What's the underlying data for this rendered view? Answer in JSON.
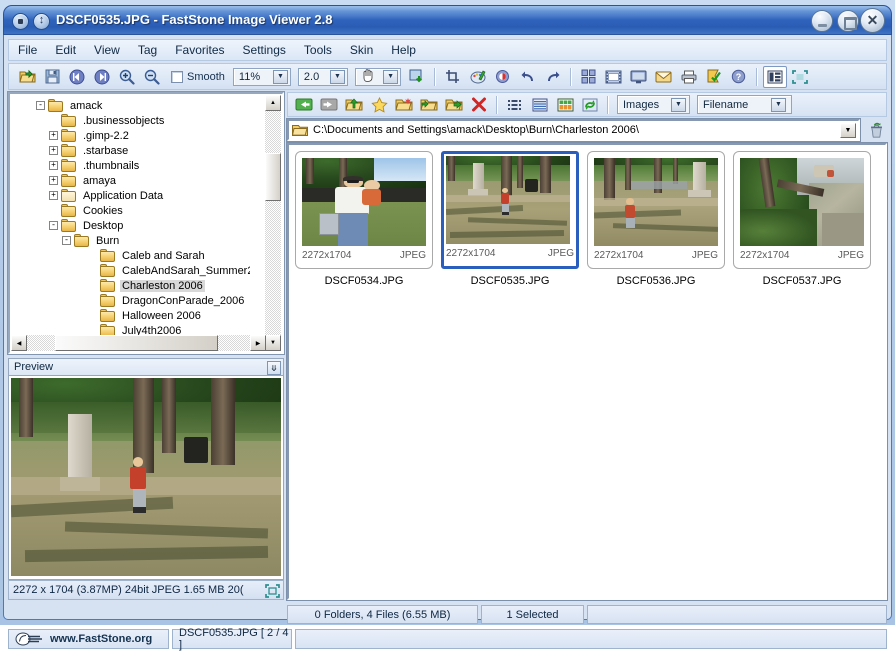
{
  "window": {
    "title": "DSCF0535.JPG  -  FastStone Image Viewer 2.8",
    "sys_menu_icon": "square-icon",
    "sys_restore_icon": "updown-arrow-icon",
    "minimize_label": "minimize-icon",
    "maximize_label": "maximize-icon",
    "close_label": "close-icon"
  },
  "menu": {
    "items": [
      {
        "label": "File"
      },
      {
        "label": "Edit"
      },
      {
        "label": "View"
      },
      {
        "label": "Tag"
      },
      {
        "label": "Favorites"
      },
      {
        "label": "Settings"
      },
      {
        "label": "Tools"
      },
      {
        "label": "Skin"
      },
      {
        "label": "Help"
      }
    ]
  },
  "toolbar_main": {
    "buttons": [
      {
        "name": "open-folder-icon",
        "tip": "Open"
      },
      {
        "name": "save-icon",
        "tip": "Save"
      },
      {
        "name": "previous-image-icon",
        "tip": "Previous"
      },
      {
        "name": "next-image-icon",
        "tip": "Next"
      },
      {
        "name": "zoom-in-icon",
        "tip": "Zoom In"
      },
      {
        "name": "zoom-out-icon",
        "tip": "Zoom Out"
      }
    ],
    "smooth_label": "Smooth",
    "smooth_checked": false,
    "zoom_value": "11%",
    "gamma_value": "2.0",
    "hand_value": "✋",
    "right_buttons": [
      {
        "name": "fit-window-icon"
      },
      {
        "name": "crop-icon"
      },
      {
        "name": "draw-board-icon"
      },
      {
        "name": "red-eye-icon"
      },
      {
        "name": "undo-icon"
      },
      {
        "name": "redo-icon"
      },
      {
        "name": "contact-sheet-icon"
      },
      {
        "name": "slideshow-film-icon"
      },
      {
        "name": "fullscreen-monitor-icon"
      },
      {
        "name": "email-icon"
      },
      {
        "name": "print-icon"
      },
      {
        "name": "tag-icon"
      },
      {
        "name": "help-icon"
      },
      {
        "name": "layout-toggle-icon"
      },
      {
        "name": "expand-view-icon"
      }
    ]
  },
  "toolbar_browser": {
    "buttons": [
      {
        "name": "back-icon"
      },
      {
        "name": "forward-icon"
      },
      {
        "name": "up-folder-icon"
      },
      {
        "name": "favorites-star-icon"
      },
      {
        "name": "new-folder-icon"
      },
      {
        "name": "copy-to-folder-icon"
      },
      {
        "name": "move-to-folder-icon"
      },
      {
        "name": "delete-icon"
      },
      {
        "name": "list-view-icon"
      },
      {
        "name": "details-view-icon"
      },
      {
        "name": "thumbnail-view-icon"
      },
      {
        "name": "refresh-icon"
      }
    ],
    "filter_value": "Images",
    "sort_value": "Filename"
  },
  "address": {
    "folder_icon": "folder-icon",
    "path": "C:\\Documents and Settings\\amack\\Desktop\\Burn\\Charleston 2006\\",
    "dropdown_icon": "chevron-down-icon",
    "trash_icon": "recycle-bin-icon"
  },
  "tree": {
    "nodes": [
      {
        "label": "amack",
        "indent": 2,
        "expander": "-",
        "selected": false,
        "pale": false
      },
      {
        "label": ".businessobjects",
        "indent": 3,
        "expander": "",
        "selected": false,
        "pale": false
      },
      {
        "label": ".gimp-2.2",
        "indent": 3,
        "expander": "+",
        "selected": false,
        "pale": false
      },
      {
        "label": ".starbase",
        "indent": 3,
        "expander": "+",
        "selected": false,
        "pale": false
      },
      {
        "label": ".thumbnails",
        "indent": 3,
        "expander": "+",
        "selected": false,
        "pale": false
      },
      {
        "label": "amaya",
        "indent": 3,
        "expander": "+",
        "selected": false,
        "pale": false
      },
      {
        "label": "Application Data",
        "indent": 3,
        "expander": "+",
        "selected": false,
        "pale": true
      },
      {
        "label": "Cookies",
        "indent": 3,
        "expander": "",
        "selected": false,
        "pale": false
      },
      {
        "label": "Desktop",
        "indent": 3,
        "expander": "-",
        "selected": false,
        "pale": false
      },
      {
        "label": "Burn",
        "indent": 4,
        "expander": "-",
        "selected": false,
        "pale": false
      },
      {
        "label": "Caleb and Sarah",
        "indent": 6,
        "expander": "",
        "selected": false,
        "pale": false
      },
      {
        "label": "CalebAndSarah_Summer2",
        "indent": 6,
        "expander": "",
        "selected": false,
        "pale": false
      },
      {
        "label": "Charleston 2006",
        "indent": 6,
        "expander": "",
        "selected": true,
        "pale": false
      },
      {
        "label": "DragonConParade_2006",
        "indent": 6,
        "expander": "",
        "selected": false,
        "pale": false
      },
      {
        "label": "Halloween 2006",
        "indent": 6,
        "expander": "",
        "selected": false,
        "pale": false
      },
      {
        "label": "July4th2006",
        "indent": 6,
        "expander": "",
        "selected": false,
        "pale": false
      }
    ]
  },
  "preview": {
    "header_label": "Preview",
    "collapse_icon": "double-chevron-down-icon",
    "status_text": "2272 x 1704 (3.87MP)   24bit JPEG   1.65 MB   20(",
    "fit_icon": "fit-to-window-icon"
  },
  "thumbnails": {
    "items": [
      {
        "filename": "DSCF0534.JPG",
        "dimensions": "2272x1704",
        "format": "JPEG",
        "selected": false,
        "scene": "father-child"
      },
      {
        "filename": "DSCF0535.JPG",
        "dimensions": "2272x1704",
        "format": "JPEG",
        "selected": true,
        "scene": "child-park"
      },
      {
        "filename": "DSCF0536.JPG",
        "dimensions": "2272x1704",
        "format": "JPEG",
        "selected": false,
        "scene": "child-monument"
      },
      {
        "filename": "DSCF0537.JPG",
        "dimensions": "2272x1704",
        "format": "JPEG",
        "selected": false,
        "scene": "tree-canopy"
      }
    ]
  },
  "status": {
    "folders_files": "0 Folders, 4 Files (6.55 MB)",
    "selection": "1 Selected",
    "website": "www.FastStone.org",
    "website_icon": "faststone-logo-icon",
    "current_file": "DSCF0535.JPG [ 2 / 4 ]"
  },
  "colors": {
    "title_blue": "#2f63bb",
    "selection_blue": "#2a5fbe",
    "panel_blue": "#d6e2f2",
    "accent_gold": "#f5cf6e"
  }
}
